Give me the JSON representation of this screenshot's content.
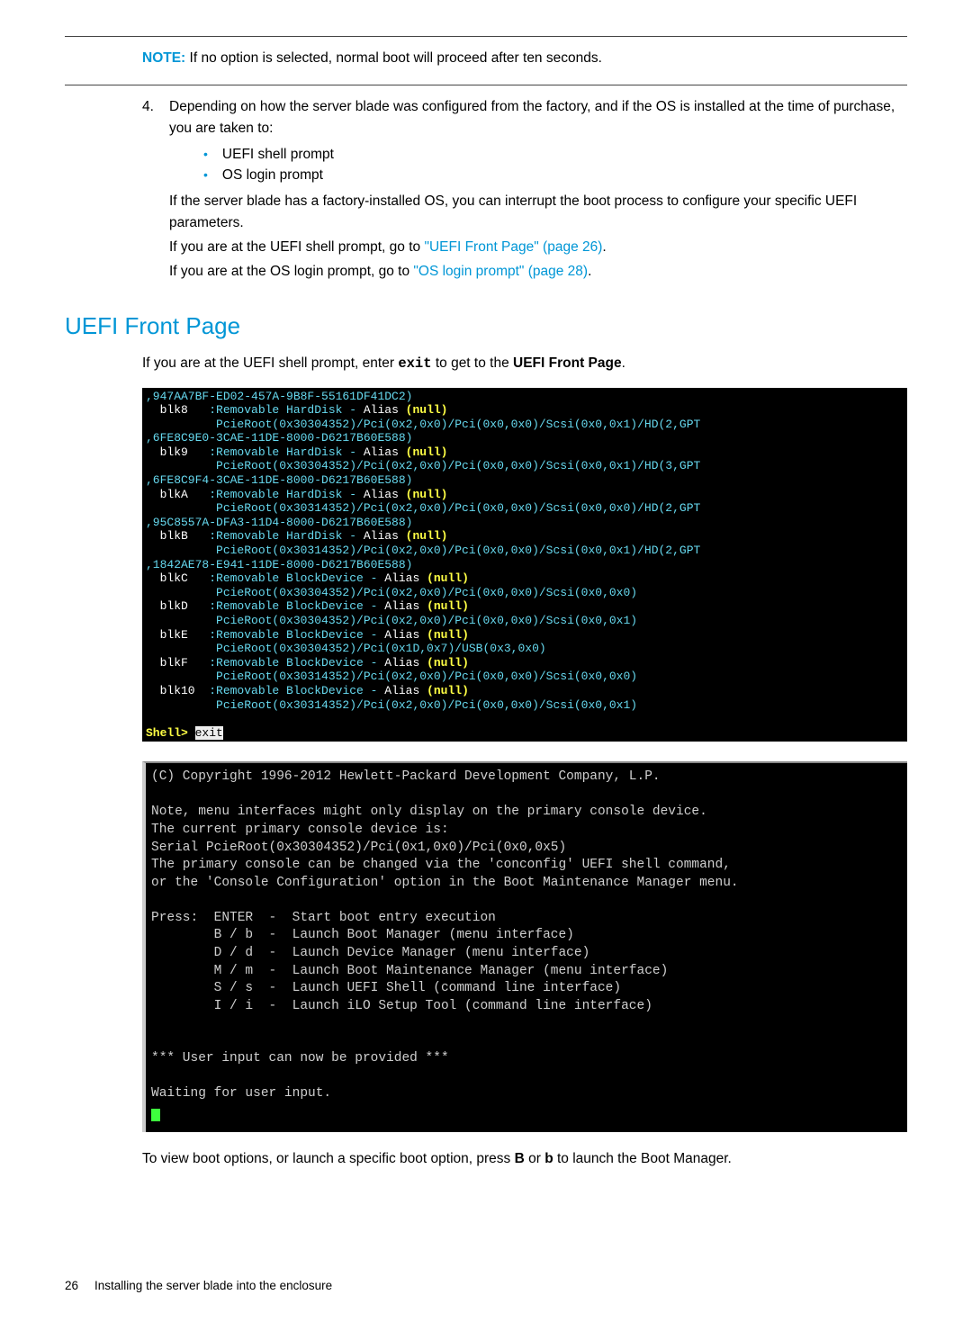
{
  "note": {
    "label": "NOTE:",
    "text": "If no option is selected, normal boot will proceed after ten seconds."
  },
  "step4": {
    "num": "4.",
    "intro": "Depending on how the server blade was configured from the factory, and if the OS is installed at the time of purchase, you are taken to:",
    "bullets": [
      "UEFI shell prompt",
      "OS login prompt"
    ],
    "para_factory": "If the server blade has a factory-installed OS, you can interrupt the boot process to configure your specific UEFI parameters.",
    "para_uefi_pre": "If you are at the UEFI shell prompt, go to ",
    "link_uefi": "\"UEFI Front Page\" (page 26)",
    "para_os_pre": "If you are at the OS login prompt, go to ",
    "link_os": "\"OS login prompt\" (page 28)",
    "period": "."
  },
  "section_title": "UEFI Front Page",
  "section": {
    "intro_pre": "If you are at the UEFI shell prompt, enter ",
    "exit_cmd": "exit",
    "intro_mid": " to get to the ",
    "intro_bold": "UEFI Front Page",
    "intro_post": "."
  },
  "term1": {
    "l01a": ",947AA7BF-ED02-457A-9B8F-55161DF41DC2)",
    "l02a": "  blk8   ",
    "l02b": ":Removable HardDisk - ",
    "l02c": "Alias ",
    "l02d": "(null)",
    "l03": "          PcieRoot(0x30304352)/Pci(0x2,0x0)/Pci(0x0,0x0)/Scsi(0x0,0x1)/HD(2,GPT",
    "l04": ",6FE8C9E0-3CAE-11DE-8000-D6217B60E588)",
    "l05a": "  blk9   ",
    "l05b": ":Removable HardDisk - ",
    "l05c": "Alias ",
    "l05d": "(null)",
    "l06": "          PcieRoot(0x30304352)/Pci(0x2,0x0)/Pci(0x0,0x0)/Scsi(0x0,0x1)/HD(3,GPT",
    "l07": ",6FE8C9F4-3CAE-11DE-8000-D6217B60E588)",
    "l08a": "  blkA   ",
    "l08b": ":Removable HardDisk - ",
    "l08c": "Alias ",
    "l08d": "(null)",
    "l09": "          PcieRoot(0x30314352)/Pci(0x2,0x0)/Pci(0x0,0x0)/Scsi(0x0,0x0)/HD(2,GPT",
    "l10": ",95C8557A-DFA3-11D4-8000-D6217B60E588)",
    "l11a": "  blkB   ",
    "l11b": ":Removable HardDisk - ",
    "l11c": "Alias ",
    "l11d": "(null)",
    "l12": "          PcieRoot(0x30314352)/Pci(0x2,0x0)/Pci(0x0,0x0)/Scsi(0x0,0x1)/HD(2,GPT",
    "l13": ",1842AE78-E941-11DE-8000-D6217B60E588)",
    "l14a": "  blkC   ",
    "l14b": ":Removable BlockDevice - ",
    "l14c": "Alias ",
    "l14d": "(null)",
    "l15": "          PcieRoot(0x30304352)/Pci(0x2,0x0)/Pci(0x0,0x0)/Scsi(0x0,0x0)",
    "l16a": "  blkD   ",
    "l16b": ":Removable BlockDevice - ",
    "l16c": "Alias ",
    "l16d": "(null)",
    "l17": "          PcieRoot(0x30304352)/Pci(0x2,0x0)/Pci(0x0,0x0)/Scsi(0x0,0x1)",
    "l18a": "  blkE   ",
    "l18b": ":Removable BlockDevice - ",
    "l18c": "Alias ",
    "l18d": "(null)",
    "l19": "          PcieRoot(0x30304352)/Pci(0x1D,0x7)/USB(0x3,0x0)",
    "l20a": "  blkF   ",
    "l20b": ":Removable BlockDevice - ",
    "l20c": "Alias ",
    "l20d": "(null)",
    "l21": "          PcieRoot(0x30314352)/Pci(0x2,0x0)/Pci(0x0,0x0)/Scsi(0x0,0x0)",
    "l22a": "  blk10  ",
    "l22b": ":Removable BlockDevice - ",
    "l22c": "Alias ",
    "l22d": "(null)",
    "l23": "          PcieRoot(0x30314352)/Pci(0x2,0x0)/Pci(0x0,0x0)/Scsi(0x0,0x1)",
    "lprompt_a": "Shell> ",
    "lprompt_b": "exit"
  },
  "term2": {
    "l01": "(C) Copyright 1996-2012 Hewlett-Packard Development Company, L.P.",
    "l02": "",
    "l03": "Note, menu interfaces might only display on the primary console device.",
    "l04": "The current primary console device is:",
    "l05": "Serial PcieRoot(0x30304352)/Pci(0x1,0x0)/Pci(0x0,0x5)",
    "l06": "The primary console can be changed via the 'conconfig' UEFI shell command,",
    "l07": "or the 'Console Configuration' option in the Boot Maintenance Manager menu.",
    "l08": "",
    "l09": "Press:  ENTER  -  Start boot entry execution",
    "l10": "        B / b  -  Launch Boot Manager (menu interface)",
    "l11": "        D / d  -  Launch Device Manager (menu interface)",
    "l12": "        M / m  -  Launch Boot Maintenance Manager (menu interface)",
    "l13": "        S / s  -  Launch UEFI Shell (command line interface)",
    "l14": "        I / i  -  Launch iLO Setup Tool (command line interface)",
    "l15": "",
    "l16": "",
    "l17": "*** User input can now be provided ***",
    "l18": "",
    "l19": "Waiting for user input."
  },
  "after": {
    "pre": "To view boot options, or launch a specific boot option, press ",
    "k1": "B",
    "mid": " or ",
    "k2": "b",
    "post": " to launch the Boot Manager."
  },
  "footer": {
    "page": "26",
    "title": "Installing the server blade into the enclosure"
  }
}
